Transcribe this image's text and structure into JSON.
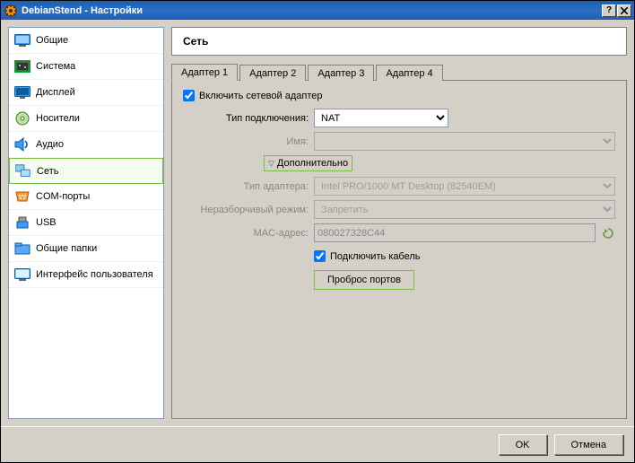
{
  "window": {
    "title": "DebianStend - Настройки"
  },
  "sidebar": {
    "items": [
      {
        "label": "Общие"
      },
      {
        "label": "Система"
      },
      {
        "label": "Дисплей"
      },
      {
        "label": "Носители"
      },
      {
        "label": "Аудио"
      },
      {
        "label": "Сеть"
      },
      {
        "label": "COM-порты"
      },
      {
        "label": "USB"
      },
      {
        "label": "Общие папки"
      },
      {
        "label": "Интерфейс пользователя"
      }
    ]
  },
  "page": {
    "title": "Сеть"
  },
  "tabs": [
    "Адаптер 1",
    "Адаптер 2",
    "Адаптер 3",
    "Адаптер 4"
  ],
  "form": {
    "enable_label": "Включить сетевой адаптер",
    "attach_label": "Тип подключения:",
    "attach_value": "NAT",
    "name_label": "Имя:",
    "advanced_label": "Дополнительно",
    "adapter_type_label": "Тип адаптера:",
    "adapter_type_value": "Intel PRO/1000 MT Desktop (82540EM)",
    "promisc_label": "Неразборчивый режим:",
    "promisc_value": "Запретить",
    "mac_label": "MAC-адрес:",
    "mac_value": "080027328C44",
    "cable_label": "Подключить кабель",
    "portfw_label": "Проброс портов"
  },
  "buttons": {
    "ok": "OK",
    "cancel": "Отмена"
  }
}
